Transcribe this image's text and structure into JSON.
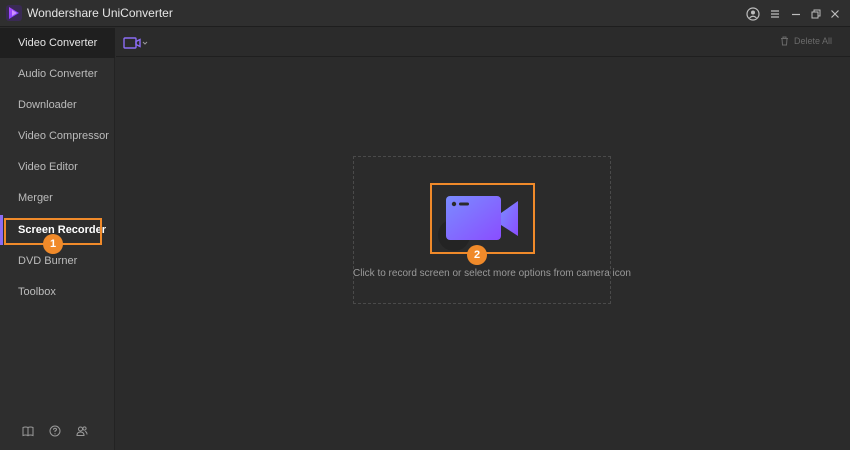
{
  "app": {
    "title": "Wondershare UniConverter"
  },
  "titlebar": {
    "account_icon": "account-icon",
    "menu_icon": "hamburger-icon",
    "minimize_icon": "minimize-icon",
    "restore_icon": "restore-icon",
    "close_icon": "close-icon"
  },
  "sidebar": {
    "items": [
      {
        "label": "Video Converter"
      },
      {
        "label": "Audio Converter"
      },
      {
        "label": "Downloader"
      },
      {
        "label": "Video Compressor"
      },
      {
        "label": "Video Editor"
      },
      {
        "label": "Merger"
      },
      {
        "label": "Screen Recorder"
      },
      {
        "label": "DVD Burner"
      },
      {
        "label": "Toolbox"
      }
    ],
    "bottom_icons": [
      "book-icon",
      "help-icon",
      "users-icon"
    ]
  },
  "toolbar": {
    "delete_all_label": "Delete All"
  },
  "main": {
    "record_hint": "Click to record screen or select more options from camera icon"
  },
  "annotations": {
    "step1": "1",
    "step2": "2"
  },
  "colors": {
    "accent_purple": "#8b6cf5",
    "highlight_orange": "#f08a2a"
  }
}
